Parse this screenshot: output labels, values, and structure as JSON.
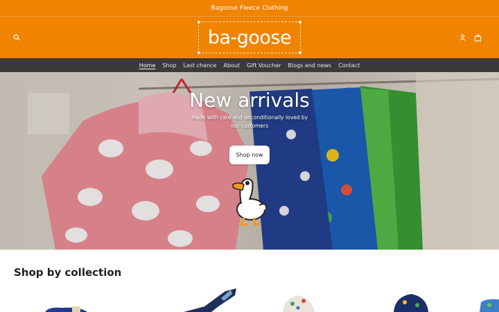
{
  "announcement": "Bagoose Fleece Clothing",
  "header": {
    "logo_text": "ba-goose",
    "icons": [
      "search-icon",
      "account-icon",
      "cart-icon"
    ]
  },
  "nav": {
    "items": [
      {
        "label": "Home",
        "active": true
      },
      {
        "label": "Shop",
        "active": false
      },
      {
        "label": "Last chance",
        "active": false
      },
      {
        "label": "About",
        "active": false
      },
      {
        "label": "Gift Voucher",
        "active": false
      },
      {
        "label": "Blogs and news",
        "active": false
      },
      {
        "label": "Contact",
        "active": false
      }
    ]
  },
  "hero": {
    "title": "New arrivals",
    "subtitle": "Made with care and unconditionally loved by our customers",
    "cta_label": "Shop now"
  },
  "collections": {
    "title": "Shop by collection"
  },
  "colors": {
    "brand_orange": "#f08300",
    "nav_dark": "#3b3a38"
  }
}
